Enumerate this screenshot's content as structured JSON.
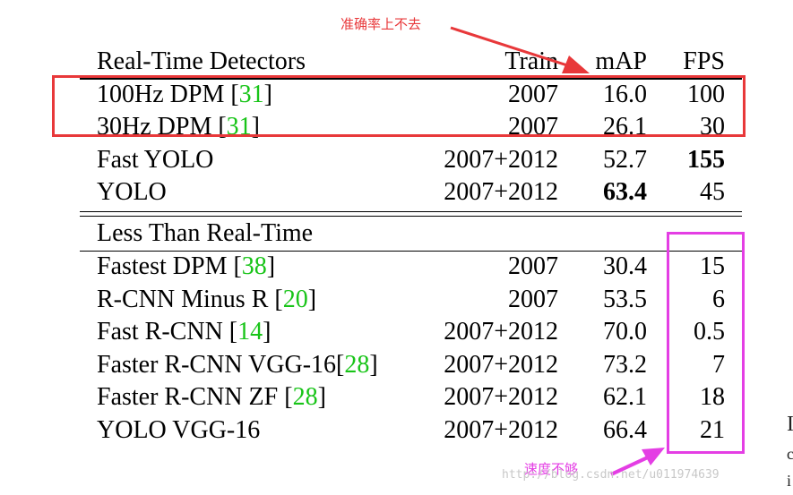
{
  "header": {
    "section": "Real-Time Detectors",
    "train": "Train",
    "map": "mAP",
    "fps": "FPS"
  },
  "realtime_rows": [
    {
      "name": "100Hz DPM ",
      "ref": "31",
      "suffix": "]",
      "train": "2007",
      "map": "16.0",
      "fps": "100"
    },
    {
      "name": "30Hz DPM ",
      "ref": "31",
      "suffix": "]",
      "train": "2007",
      "map": "26.1",
      "fps": "30"
    },
    {
      "name": "Fast YOLO",
      "ref": "",
      "suffix": "",
      "train": "2007+2012",
      "map": "52.7",
      "fps": "155"
    },
    {
      "name": "YOLO",
      "ref": "",
      "suffix": "",
      "train": "2007+2012",
      "map": "63.4",
      "fps": "45"
    }
  ],
  "section2": {
    "title": "Less Than Real-Time"
  },
  "slow_rows": [
    {
      "name": "Fastest DPM ",
      "ref": "38",
      "train": "2007",
      "map": "30.4",
      "fps": "15"
    },
    {
      "name": "R-CNN Minus R ",
      "ref": "20",
      "train": "2007",
      "map": "53.5",
      "fps": "6"
    },
    {
      "name": "Fast R-CNN ",
      "ref": "14",
      "train": "2007+2012",
      "map": "70.0",
      "fps": "0.5"
    },
    {
      "name": "Faster R-CNN VGG-16",
      "ref": "28",
      "train": "2007+2012",
      "map": "73.2",
      "fps": "7"
    },
    {
      "name": "Faster R-CNN ZF ",
      "ref": "28",
      "train": "2007+2012",
      "map": "62.1",
      "fps": "18"
    },
    {
      "name": "YOLO VGG-16",
      "ref": "",
      "train": "2007+2012",
      "map": "66.4",
      "fps": "21"
    }
  ],
  "annotations": {
    "accuracy_note": "准确率上不去",
    "speed_note": "速度不够"
  },
  "watermark": "http://blog.csdn.net/u011974639",
  "edge_fragments": [
    "I",
    "c",
    "i"
  ],
  "colors": {
    "reference": "#18c418",
    "annotation_red": "#e8383a",
    "annotation_pink": "#e43ee4"
  }
}
